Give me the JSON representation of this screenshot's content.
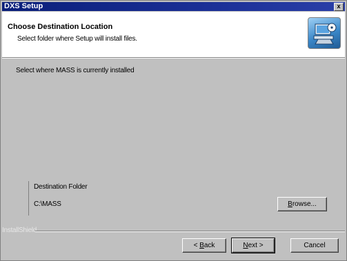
{
  "window": {
    "title": "DXS Setup",
    "close_symbol": "x"
  },
  "header": {
    "title": "Choose Destination Location",
    "subtitle": "Select folder where Setup will install files.",
    "icon": "setup-computer-icon"
  },
  "body": {
    "prompt": "Select where MASS is currently installed"
  },
  "destination": {
    "group_label": "Destination Folder",
    "path": "C:\\MASS",
    "browse_pre": "",
    "browse_ul": "B",
    "browse_post": "rowse..."
  },
  "footer": {
    "brand": "InstallShield",
    "back_pre": "< ",
    "back_ul": "B",
    "back_post": "ack",
    "next_ul": "N",
    "next_post": "ext >",
    "cancel": "Cancel"
  },
  "colors": {
    "title_bar": "#0a1f7a",
    "face": "#c0c0c0",
    "header_bg": "#ffffff"
  }
}
